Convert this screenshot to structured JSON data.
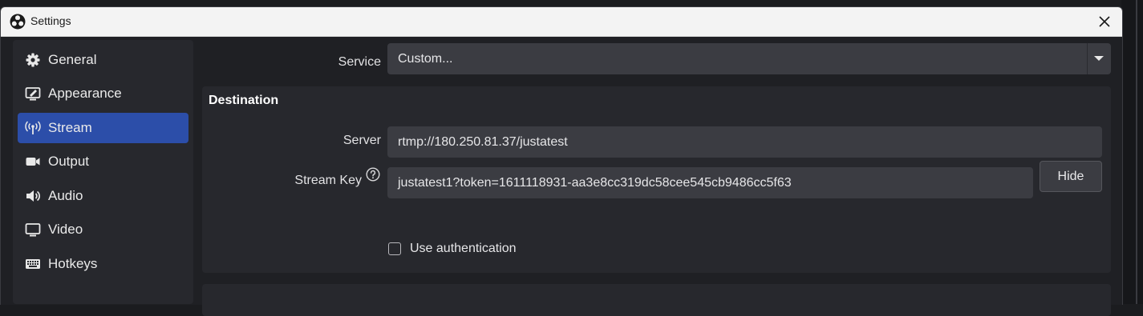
{
  "window": {
    "title": "Settings"
  },
  "sidebar": {
    "items": [
      {
        "label": "General",
        "icon": "gear-icon",
        "active": false
      },
      {
        "label": "Appearance",
        "icon": "appearance-icon",
        "active": false
      },
      {
        "label": "Stream",
        "icon": "broadcast-icon",
        "active": true
      },
      {
        "label": "Output",
        "icon": "camera-icon",
        "active": false
      },
      {
        "label": "Audio",
        "icon": "speaker-icon",
        "active": false
      },
      {
        "label": "Video",
        "icon": "monitor-icon",
        "active": false
      },
      {
        "label": "Hotkeys",
        "icon": "keyboard-icon",
        "active": false
      }
    ]
  },
  "service": {
    "label": "Service",
    "value": "Custom..."
  },
  "destination": {
    "title": "Destination",
    "server_label": "Server",
    "server_value": "rtmp://180.250.81.37/justatest",
    "stream_key_label": "Stream Key",
    "stream_key_value": "justatest1?token=1611118931-aa3e8cc319dc58cee545cb9486cc5f63",
    "hide_button": "Hide",
    "use_auth_label": "Use authentication",
    "use_auth_checked": false
  },
  "colors": {
    "accent": "#2c4ea9",
    "panel": "#27282d",
    "field": "#3b3c42"
  }
}
